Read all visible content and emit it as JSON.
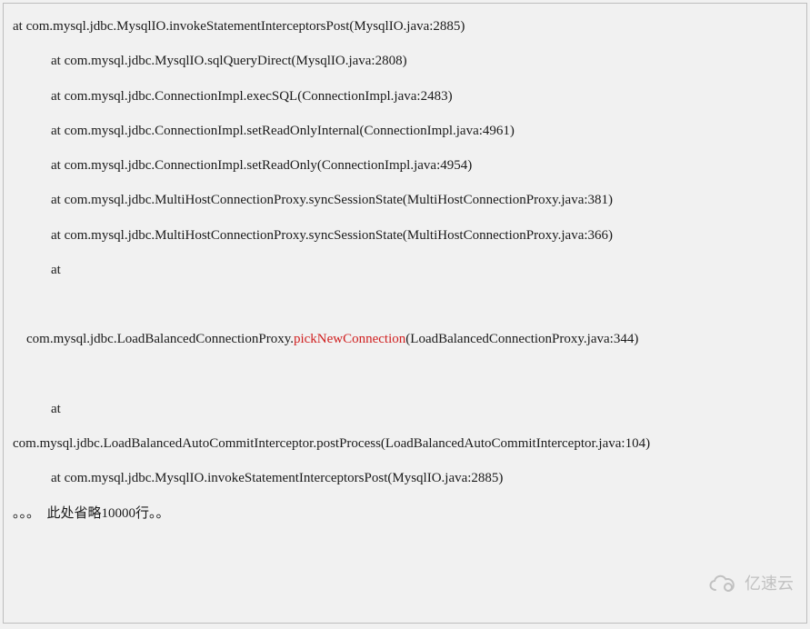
{
  "stack": {
    "line1": "at com.mysql.jdbc.MysqlIO.invokeStatementInterceptorsPost(MysqlIO.java:2885)",
    "line2": "at com.mysql.jdbc.MysqlIO.sqlQueryDirect(MysqlIO.java:2808)",
    "line3": "at com.mysql.jdbc.ConnectionImpl.execSQL(ConnectionImpl.java:2483)",
    "line4": "at com.mysql.jdbc.ConnectionImpl.setReadOnlyInternal(ConnectionImpl.java:4961)",
    "line5": "at com.mysql.jdbc.ConnectionImpl.setReadOnly(ConnectionImpl.java:4954)",
    "line6": "at com.mysql.jdbc.MultiHostConnectionProxy.syncSessionState(MultiHostConnectionProxy.java:381)",
    "line7": "at com.mysql.jdbc.MultiHostConnectionProxy.syncSessionState(MultiHostConnectionProxy.java:366)",
    "line8": "at",
    "line9a": "com.mysql.jdbc.LoadBalancedConnectionProxy.",
    "line9b": "pickNewConnection",
    "line9c": "(LoadBalancedConnectionProxy.java:344)",
    "line10": "at",
    "line11": "com.mysql.jdbc.LoadBalancedAutoCommitInterceptor.postProcess(LoadBalancedAutoCommitInterceptor.java:104)",
    "line12": "at com.mysql.jdbc.MysqlIO.invokeStatementInterceptorsPost(MysqlIO.java:2885)",
    "ellipsis": "。。。  此处省略10000行。。"
  },
  "watermark": {
    "text": "亿速云"
  }
}
